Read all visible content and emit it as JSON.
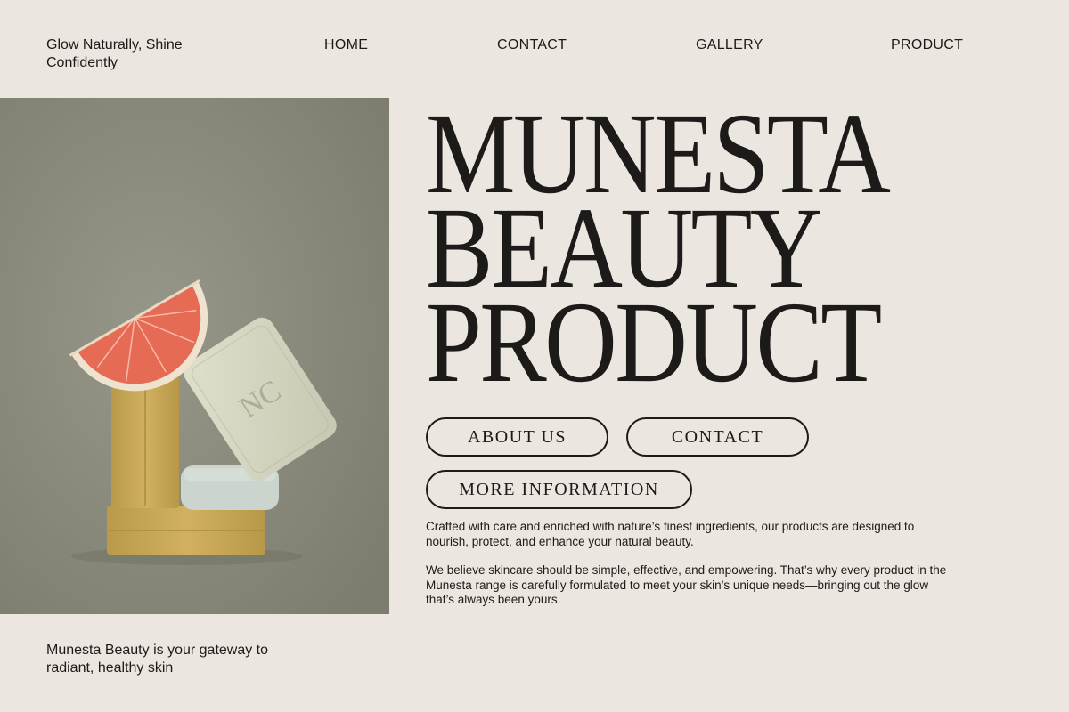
{
  "tagline": "Glow Naturally, Shine\nConfidently",
  "nav": {
    "home": "HOME",
    "contact": "CONTACT",
    "gallery": "GALLERY",
    "product": "PRODUCT"
  },
  "hero": {
    "line1": "MUNESTA",
    "line2": "BEAUTY",
    "line3": "PRODUCT"
  },
  "buttons": {
    "about": "ABOUT US",
    "contact": "CONTACT",
    "more": "MORE INFORMATION"
  },
  "paragraphs": {
    "p1": "Crafted with care and enriched with nature’s finest ingredients, our products are designed to nourish, protect, and enhance your natural beauty.",
    "p2": "We believe skincare should be simple, effective, and empowering. That’s why every product in the Munesta range is carefully formulated to meet your skin’s unique needs—bringing out the glow that’s always been yours."
  },
  "bottom_note": "Munesta Beauty is your gateway to radiant, healthy skin",
  "photo": {
    "soap_monogram": "NC"
  },
  "colors": {
    "background": "#ece6e0",
    "text": "#1d1b1a",
    "photo_background": "#8a8a7c",
    "grapefruit": "#e8705c",
    "yellow_soap": "#c9a955",
    "cream_soap": "#d6d7c2",
    "mint_soap": "#c9d3cb"
  }
}
